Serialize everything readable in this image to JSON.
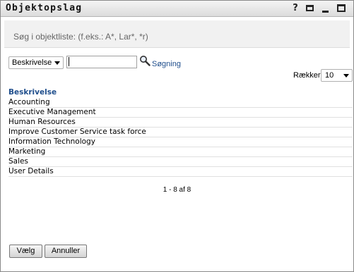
{
  "window": {
    "title": "Objektopslag",
    "help_label": "?"
  },
  "hint": {
    "text": "Søg i objektliste: (f.eks.: A*, Lar*, *r)"
  },
  "search": {
    "field_select": "Beskrivelse",
    "input_value": "",
    "link_label": "Søgning"
  },
  "rows": {
    "label": "Rækker:",
    "value": "10"
  },
  "list": {
    "header": "Beskrivelse",
    "items": [
      "Accounting",
      "Executive Management",
      "Human Resources",
      "Improve Customer Service task force",
      "Information Technology",
      "Marketing",
      "Sales",
      "User Details"
    ]
  },
  "pager": {
    "text": "1 - 8 af 8"
  },
  "buttons": {
    "choose": "Vælg",
    "cancel": "Annuller"
  },
  "colors": {
    "link": "#1f4e8c",
    "hint_bg": "#f1f1f1"
  }
}
